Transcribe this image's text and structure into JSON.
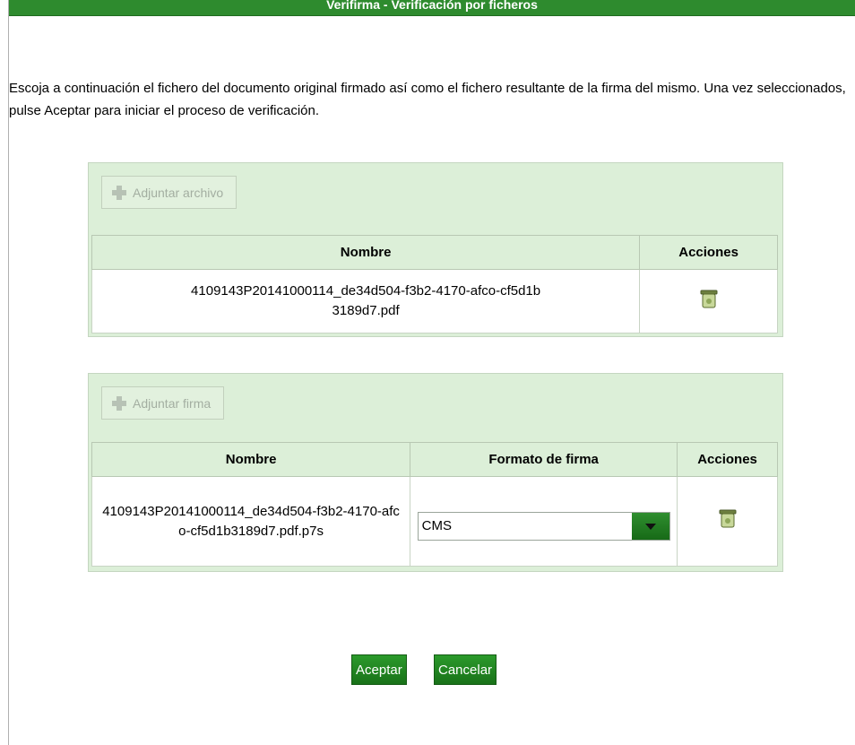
{
  "header": {
    "title": "Verifirma - Verificación por ficheros"
  },
  "intro_text": "Escoja a continuación el fichero del documento original firmado así como el fichero resultante de la firma del mismo. Una vez seleccionados, pulse Aceptar para iniciar el proceso de verificación.",
  "document_panel": {
    "attach_label": "Adjuntar archivo",
    "columns": {
      "name": "Nombre",
      "actions": "Acciones"
    },
    "file": {
      "name": "4109143P20141000114_de34d504-f3b2-4170-afco-cf5d1b3189d7.pdf"
    }
  },
  "signature_panel": {
    "attach_label": "Adjuntar firma",
    "columns": {
      "name": "Nombre",
      "format": "Formato de firma",
      "actions": "Acciones"
    },
    "file": {
      "name": "4109143P20141000114_de34d504-f3b2-4170-afco-cf5d1b3189d7.pdf.p7s",
      "format": "CMS"
    }
  },
  "buttons": {
    "accept": "Aceptar",
    "cancel": "Cancelar"
  },
  "icons": {
    "add": "plus-icon",
    "delete": "trash-icon",
    "dropdown": "chevron-down-icon"
  },
  "colors": {
    "accent": "#2e8b2e",
    "panel_bg": "#dcefd8"
  }
}
